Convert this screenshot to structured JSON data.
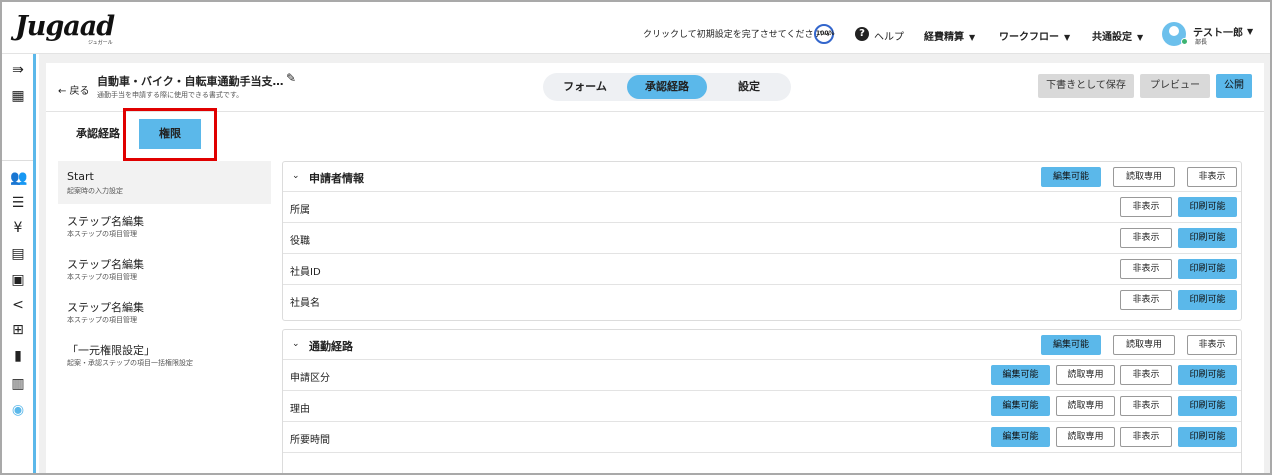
{
  "header": {
    "logo": "Jugaad",
    "logo_sub": "ジュガール",
    "setup_text": "クリックして初期設定を完了させてください→",
    "setup_progress": "100%",
    "help_label": "ヘルプ",
    "menus": [
      "経費精算",
      "ワークフロー",
      "共通設定"
    ],
    "user_name": "テスト一郎",
    "user_role": "部長"
  },
  "rail": {
    "icons": [
      "collapse-icon",
      "building-icon",
      "users-icon",
      "list-icon",
      "yen-icon",
      "form-icon",
      "document-icon",
      "share-icon",
      "grid-icon",
      "file-icon",
      "book-icon",
      "globe-icon"
    ]
  },
  "editor": {
    "back_label": "← 戻る",
    "title": "自動車・バイク・自転車通勤手当支…",
    "subtitle": "通勤手当を申請する際に使用できる書式です。",
    "tabs": [
      {
        "label": "フォーム",
        "active": false
      },
      {
        "label": "承認経路",
        "active": true
      },
      {
        "label": "設定",
        "active": false
      }
    ],
    "save_draft": "下書きとして保存",
    "preview": "プレビュー",
    "publish": "公開",
    "subtabs": [
      {
        "label": "承認経路",
        "active": false
      },
      {
        "label": "権限",
        "active": true
      }
    ]
  },
  "steps": [
    {
      "name": "Start",
      "desc": "起案時の入力設定",
      "selected": true
    },
    {
      "name": "ステップ名編集",
      "desc": "本ステップの項目管理",
      "selected": false
    },
    {
      "name": "ステップ名編集",
      "desc": "本ステップの項目管理",
      "selected": false
    },
    {
      "name": "ステップ名編集",
      "desc": "本ステップの項目管理",
      "selected": false
    },
    {
      "name": "「一元権限設定」",
      "desc": "起案・承認ステップの項目一括権限設定",
      "selected": false
    }
  ],
  "sections": [
    {
      "title": "申請者情報",
      "header_buttons": [
        {
          "label": "編集可能",
          "active": true
        },
        {
          "label": "読取専用",
          "active": false
        },
        {
          "label": "非表示",
          "active": false
        }
      ],
      "rows": [
        {
          "label": "所属",
          "buttons": [
            {
              "label": "非表示",
              "active": false
            },
            {
              "label": "印刷可能",
              "active": true
            }
          ]
        },
        {
          "label": "役職",
          "buttons": [
            {
              "label": "非表示",
              "active": false
            },
            {
              "label": "印刷可能",
              "active": true
            }
          ]
        },
        {
          "label": "社員ID",
          "buttons": [
            {
              "label": "非表示",
              "active": false
            },
            {
              "label": "印刷可能",
              "active": true
            }
          ]
        },
        {
          "label": "社員名",
          "buttons": [
            {
              "label": "非表示",
              "active": false
            },
            {
              "label": "印刷可能",
              "active": true
            }
          ]
        }
      ]
    },
    {
      "title": "通勤経路",
      "header_buttons": [
        {
          "label": "編集可能",
          "active": true
        },
        {
          "label": "読取専用",
          "active": false
        },
        {
          "label": "非表示",
          "active": false
        }
      ],
      "rows": [
        {
          "label": "申請区分",
          "buttons": [
            {
              "label": "編集可能",
              "active": true
            },
            {
              "label": "読取専用",
              "active": false
            },
            {
              "label": "非表示",
              "active": false
            },
            {
              "label": "印刷可能",
              "active": true
            }
          ]
        },
        {
          "label": "理由",
          "buttons": [
            {
              "label": "編集可能",
              "active": true
            },
            {
              "label": "読取専用",
              "active": false
            },
            {
              "label": "非表示",
              "active": false
            },
            {
              "label": "印刷可能",
              "active": true
            }
          ]
        },
        {
          "label": "所要時間",
          "buttons": [
            {
              "label": "編集可能",
              "active": true
            },
            {
              "label": "読取専用",
              "active": false
            },
            {
              "label": "非表示",
              "active": false
            },
            {
              "label": "印刷可能",
              "active": true
            }
          ]
        }
      ]
    }
  ],
  "colors": {
    "accent": "#5bb8ea",
    "highlight": "#e00000"
  }
}
